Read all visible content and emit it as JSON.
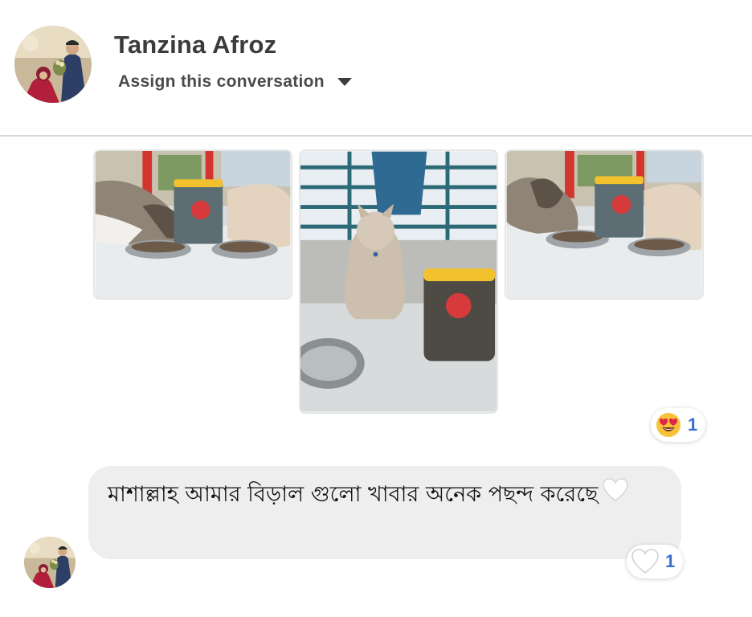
{
  "header": {
    "contact_name": "Tanzina Afroz",
    "assign_label": "Assign this conversation",
    "assign_icon": "caret-down-icon"
  },
  "photos": [
    {
      "name": "photo-two-cats-eating",
      "icon": "image"
    },
    {
      "name": "photo-cat-sitting",
      "icon": "image"
    },
    {
      "name": "photo-two-cats-eating-2",
      "icon": "image"
    }
  ],
  "photo_reaction": {
    "emoji": "heart-eyes-emoji-icon",
    "count": "1"
  },
  "message": {
    "text": "মাশাল্লাহ  আমার বিড়াল গুলো খাবার অনেক পছন্দ করেছে",
    "trailing_emoji": "white-heart-icon",
    "reaction": {
      "emoji": "white-heart-icon",
      "count": "1"
    }
  },
  "colors": {
    "bubble_bg": "#eeeeee",
    "reaction_count": "#3b6fd6",
    "divider": "#d9d9d9"
  }
}
